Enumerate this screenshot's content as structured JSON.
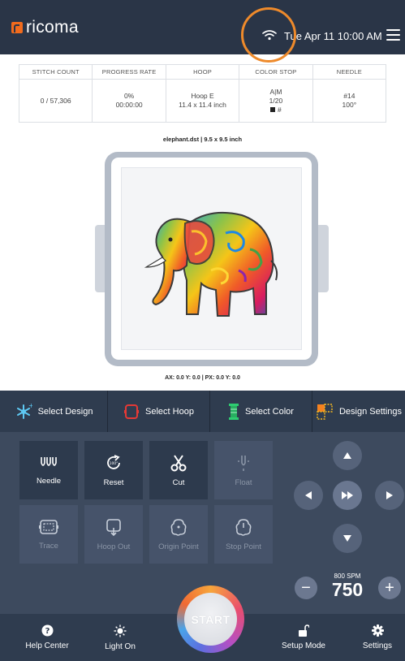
{
  "header": {
    "brand": "ricoma",
    "datetime": "Tue Apr 11  10:00 AM"
  },
  "stats": {
    "stitch_count": {
      "label": "STITCH COUNT",
      "value": "0 / 57,306"
    },
    "progress": {
      "label": "PROGRESS RATE",
      "percent": "0%",
      "time": "00:00:00"
    },
    "hoop": {
      "label": "HOOP",
      "name": "Hoop E",
      "size": "11.4 x 11.4 inch"
    },
    "color_stop": {
      "label": "COLOR STOP",
      "mode": "A|M",
      "count": "1/20",
      "color_tag": "#"
    },
    "needle": {
      "label": "NEEDLE",
      "number": "#14",
      "angle": "100°"
    }
  },
  "design": {
    "file_info": "elephant.dst  |  9.5 x 9.5 inch",
    "coordinates": "AX: 0.0  Y: 0.0   |   PX: 0.0  Y: 0.0"
  },
  "toolbar": {
    "select_design": "Select Design",
    "select_hoop": "Select Hoop",
    "select_color": "Select Color",
    "design_settings": "Design Settings"
  },
  "controls": {
    "needle": "Needle",
    "reset": "Reset",
    "cut": "Cut",
    "float": "Float",
    "trace": "Trace",
    "hoop_out": "Hoop Out",
    "origin_point": "Origin Point",
    "stop_point": "Stop Point",
    "reset_badge": "100°"
  },
  "speed": {
    "max_label": "800 SPM",
    "value": "750",
    "minus": "−",
    "plus": "+"
  },
  "bottom": {
    "help_center": "Help Center",
    "light_on": "Light On",
    "start": "START",
    "setup_mode": "Setup Mode",
    "settings": "Settings"
  },
  "colors": {
    "header_bg": "#2a3547",
    "toolbar_bg": "#2f3c4f",
    "panel_bg": "#3d4a5e",
    "brand_orange": "#f26b1d",
    "highlight_ring": "#ee8a2b"
  }
}
